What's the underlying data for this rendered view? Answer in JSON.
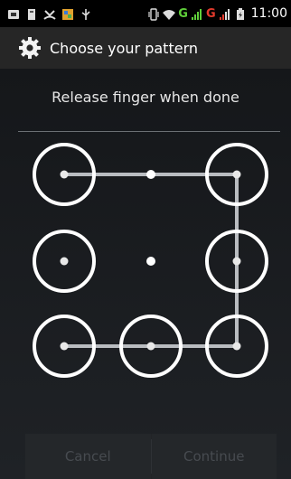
{
  "status_bar": {
    "time": "11:00",
    "network_label_1": "G",
    "network_label_2": "G",
    "icons": [
      "sim-icon",
      "storage-icon",
      "missed-call-icon",
      "gallery-icon",
      "usb-icon",
      "vibrate-icon",
      "wifi-icon",
      "signal-icon",
      "signal-icon-2",
      "battery-icon"
    ],
    "colors": {
      "network_green": "#5fcf3a",
      "network_red": "#e33a2c"
    }
  },
  "action_bar": {
    "icon": "gear-icon",
    "title": "Choose your pattern"
  },
  "pattern_screen": {
    "header_message": "Release finger when done",
    "pattern": {
      "grid": [
        [
          true,
          false,
          true
        ],
        [
          true,
          false,
          true
        ],
        [
          true,
          true,
          true
        ]
      ],
      "path": [
        [
          0,
          0
        ],
        [
          1,
          0
        ],
        [
          2,
          0
        ],
        [
          2,
          1
        ],
        [
          2,
          2
        ],
        [
          1,
          2
        ],
        [
          0,
          2
        ]
      ],
      "ring_color": "#ffffff",
      "line_color": "#b9bcc0"
    }
  },
  "buttons": {
    "cancel_label": "Cancel",
    "continue_label": "Continue"
  }
}
